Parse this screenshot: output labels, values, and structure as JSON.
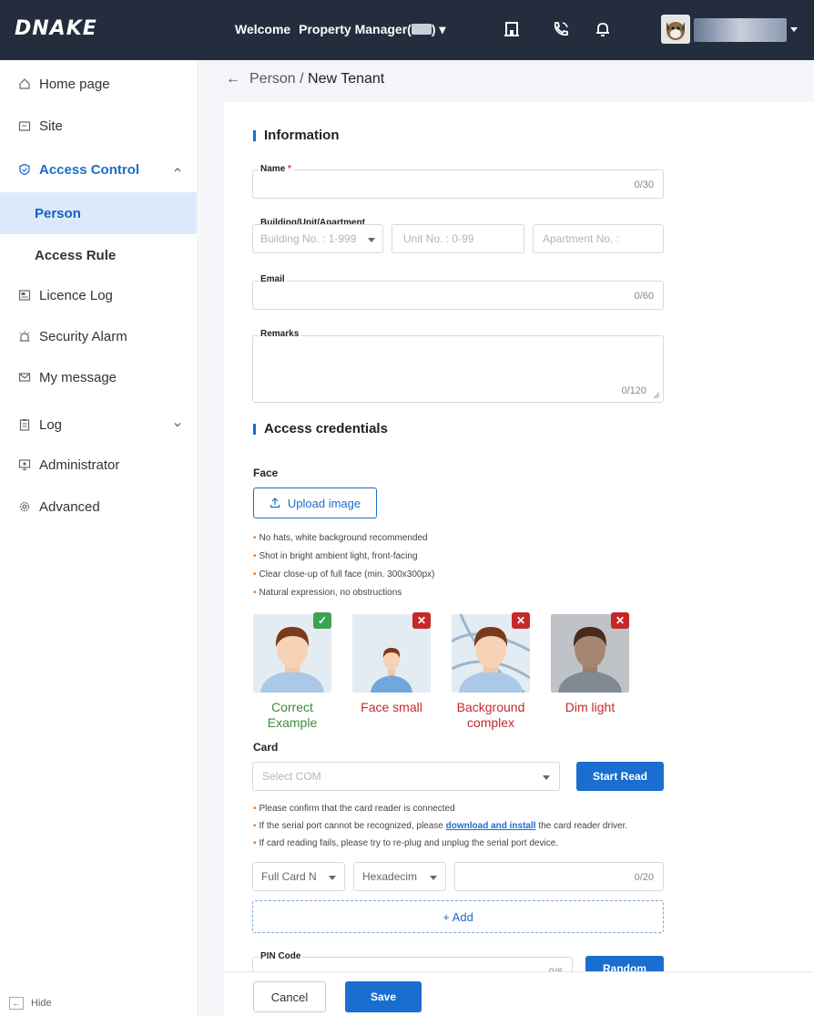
{
  "header": {
    "logo": "DNAKE",
    "welcome_prefix": "Welcome",
    "role_label": "Property Manager(",
    "role_suffix": ") ▾",
    "icons": [
      "building-icon",
      "phone-icon",
      "bell-icon"
    ]
  },
  "sidebar": {
    "items": [
      {
        "label": "Home page",
        "icon": "home-icon"
      },
      {
        "label": "Site",
        "icon": "folder-icon"
      },
      {
        "label": "Access Control",
        "icon": "shield-icon"
      },
      {
        "label": "Person"
      },
      {
        "label": "Access Rule"
      },
      {
        "label": "Licence Log",
        "icon": "licence-icon"
      },
      {
        "label": "Security Alarm",
        "icon": "alarm-icon"
      },
      {
        "label": "My message",
        "icon": "mail-icon"
      },
      {
        "label": "Log",
        "icon": "clipboard-icon"
      },
      {
        "label": "Administrator",
        "icon": "monitor-icon"
      },
      {
        "label": "Advanced",
        "icon": "gear-icon"
      }
    ],
    "hide_label": "Hide"
  },
  "breadcrumb": {
    "parent": "Person",
    "sep": " / ",
    "current": "New Tenant"
  },
  "information": {
    "title": "Information",
    "name": {
      "label": "Name",
      "required": "*",
      "value": "",
      "counter": "0/30"
    },
    "building": {
      "label": "Building/Unit/Apartment",
      "building_ph": "Building No. : 1-999",
      "unit_ph": "Unit No. : 0-99",
      "apartment_ph": "Apartment No. :"
    },
    "email": {
      "label": "Email",
      "value": "",
      "counter": "0/60"
    },
    "remarks": {
      "label": "Remarks",
      "value": "",
      "counter": "0/120"
    }
  },
  "credentials": {
    "title": "Access credentials",
    "face": {
      "label": "Face",
      "upload_label": "Upload image",
      "hints": [
        "No hats, white background recommended",
        "Shot in bright ambient light, front-facing",
        "Clear close-up of full face (min. 300x300px)",
        "Natural expression, no obstructions"
      ],
      "examples": [
        {
          "cap1": "Correct",
          "cap2": "Example",
          "status": "✓"
        },
        {
          "cap1": "Face small",
          "cap2": "",
          "status": "✕"
        },
        {
          "cap1": "Background",
          "cap2": "complex",
          "status": "✕"
        },
        {
          "cap1": "Dim light",
          "cap2": "",
          "status": "✕"
        }
      ]
    },
    "card": {
      "label": "Card",
      "com_ph": "Select COM",
      "start_read": "Start Read",
      "hint1": "Please confirm that the card reader is connected",
      "hint2_pre": "If the serial port cannot be recognized, please ",
      "hint2_link": "download and install",
      "hint2_post": " the card reader driver.",
      "hint3": "If card reading fails, please try to re-plug and unplug the serial port device.",
      "format": "Full Card N",
      "encoding": "Hexadecim",
      "card_counter": "0/20",
      "add_label": "+ Add"
    },
    "pin": {
      "label": "PIN Code",
      "counter": "0/6",
      "random": "Random"
    }
  },
  "footer": {
    "cancel": "Cancel",
    "save": "Save"
  },
  "colors": {
    "primary": "#1a6ecf",
    "topbar": "#232d3d",
    "success": "#3aa351",
    "danger": "#c62828"
  }
}
